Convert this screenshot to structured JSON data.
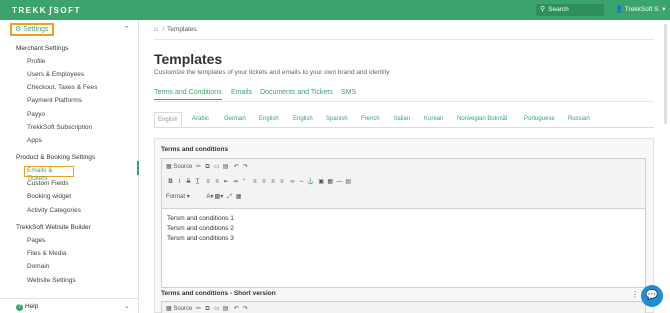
{
  "topbar": {
    "logo_left": "TREKK",
    "logo_right": "SOFT",
    "search_placeholder": "Search",
    "user": "TrekkSoft S."
  },
  "sidebar": {
    "settings_label": "Settings",
    "sections": [
      {
        "title": "Merchant Settings",
        "items": [
          "Profile",
          "Users & Employees",
          "Checkout, Taxes & Fees",
          "Payment Platforms",
          "Payyo",
          "TrekkSoft Subscription",
          "Apps"
        ]
      },
      {
        "title": "Product & Booking Settings",
        "items": [
          "Emails & Tickets",
          "Custom Fields",
          "Booking widget",
          "Activity Categories"
        ]
      },
      {
        "title": "TrekkSoft Website Builder",
        "items": [
          "Pages",
          "Files & Media",
          "Domain",
          "Website Settings"
        ]
      }
    ],
    "help_label": "Help"
  },
  "breadcrumb": {
    "current": "Templates"
  },
  "page": {
    "title": "Templates",
    "subtitle": "Customize the templates of your tickets and emails to your own brand and identity"
  },
  "tabs": [
    "Terms and Conditions",
    "Emails",
    "Documents and Tickets",
    "SMS"
  ],
  "languages": [
    "English",
    "Arabic",
    "German",
    "English",
    "English",
    "Spanish",
    "French",
    "Italian",
    "Korean",
    "Norwegian Bokmål",
    "Portuguese",
    "Russian"
  ],
  "panel": {
    "label": "Terms and conditions",
    "toolbar": {
      "source": "Source",
      "format": "Format"
    },
    "lines": [
      "Tersm and conditions 1",
      "Tersm and conditions 2",
      "Tersm and conditions 3"
    ],
    "short_label": "Terms and conditions - Short version"
  },
  "colors": {
    "brand_green": "#3aa46c",
    "highlight": "#f0a020",
    "chat": "#1f8fd2"
  }
}
